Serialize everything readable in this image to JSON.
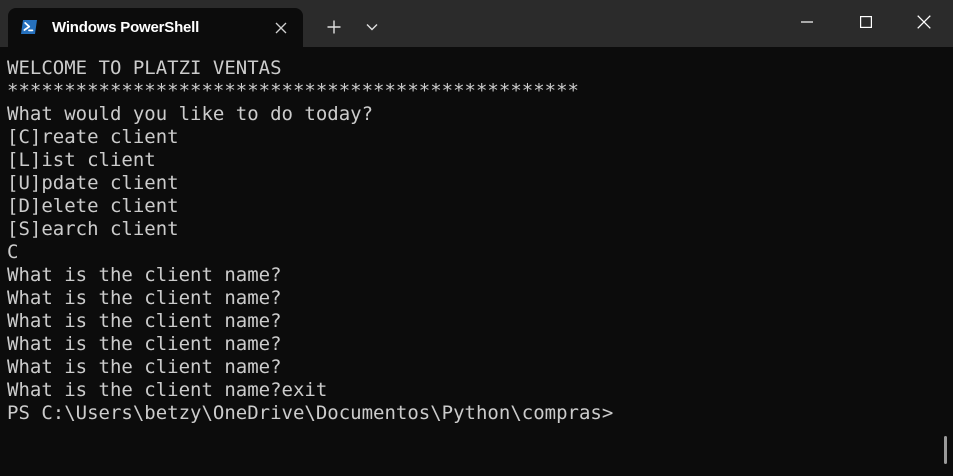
{
  "window": {
    "tab_title": "Windows PowerShell",
    "tab_icon": "powershell-icon",
    "accent_color": "#2671be"
  },
  "terminal": {
    "lines": [
      "WELCOME TO PLATZI VENTAS",
      "**************************************************",
      "What would you like to do today?",
      "[C]reate client",
      "[L]ist client",
      "[U]pdate client",
      "[D]elete client",
      "[S]earch client",
      "C",
      "What is the client name?",
      "What is the client name?",
      "What is the client name?",
      "What is the client name?",
      "What is the client name?",
      "What is the client name?exit",
      "PS C:\\Users\\betzy\\OneDrive\\Documentos\\Python\\compras>"
    ],
    "background": "#0c0c0c",
    "foreground": "#cccccc"
  }
}
